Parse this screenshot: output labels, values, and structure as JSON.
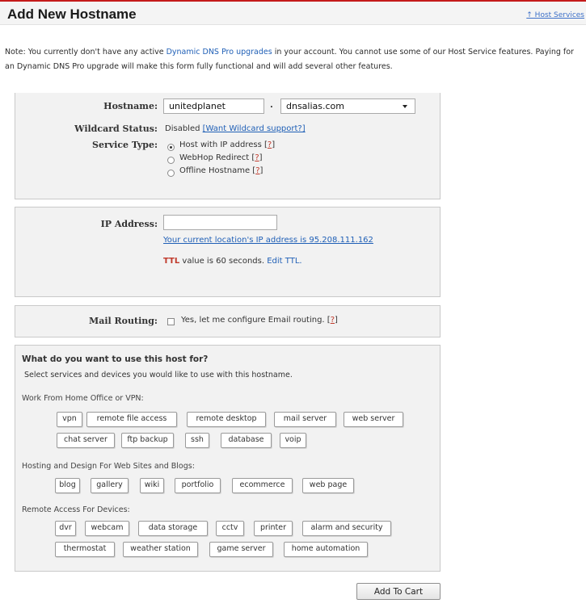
{
  "header": {
    "title": "Add New Hostname",
    "host_services_link": "↑ Host Services"
  },
  "note": {
    "prefix": "Note: You currently don't have any active ",
    "link": "Dynamic DNS Pro upgrades",
    "suffix": " in your account. You cannot use some of our Host Service features. Paying for an Dynamic DNS Pro upgrade will make this form fully functional and will add several other features."
  },
  "hostname_section": {
    "hostname_label": "Hostname:",
    "hostname_value": "unitedplanet",
    "dot": ".",
    "domain_value": "dnsalias.com",
    "wildcard_label": "Wildcard Status:",
    "wildcard_value": "Disabled",
    "wildcard_link": "[Want Wildcard support?]",
    "service_type_label": "Service Type:",
    "service_types": [
      {
        "label": "Host with IP address",
        "help": "?",
        "selected": true
      },
      {
        "label": "WebHop Redirect",
        "help": "?",
        "selected": false
      },
      {
        "label": "Offline Hostname",
        "help": "?",
        "selected": false
      }
    ]
  },
  "ip_section": {
    "ip_label": "IP Address:",
    "ip_value": "",
    "current_ip_link": "Your current location's IP address is 95.208.111.162",
    "ttl_abbr": "TTL",
    "ttl_text": " value is 60 seconds. ",
    "edit_ttl_link": "Edit TTL."
  },
  "mail_section": {
    "label": "Mail Routing:",
    "checkbox_text": "Yes, let me configure Email routing.",
    "checked": false,
    "help": "?"
  },
  "services_section": {
    "title": "What do you want to use this host for?",
    "subtitle": "Select services and devices you would like to use with this hostname.",
    "groups": [
      {
        "label": "Work From Home Office or VPN:",
        "tags": [
          "vpn",
          "remote file access",
          "remote desktop",
          "mail server",
          "web server",
          "chat server",
          "ftp backup",
          "ssh",
          "database",
          "voip"
        ]
      },
      {
        "label": "Hosting and Design For Web Sites and Blogs:",
        "tags": [
          "blog",
          "gallery",
          "wiki",
          "portfolio",
          "ecommerce",
          "web page"
        ]
      },
      {
        "label": "Remote Access For Devices:",
        "tags": [
          "dvr",
          "webcam",
          "data storage",
          "cctv",
          "printer",
          "alarm and security",
          "thermostat",
          "weather station",
          "game server",
          "home automation"
        ]
      }
    ]
  },
  "actions": {
    "add_to_cart": "Add To Cart"
  }
}
